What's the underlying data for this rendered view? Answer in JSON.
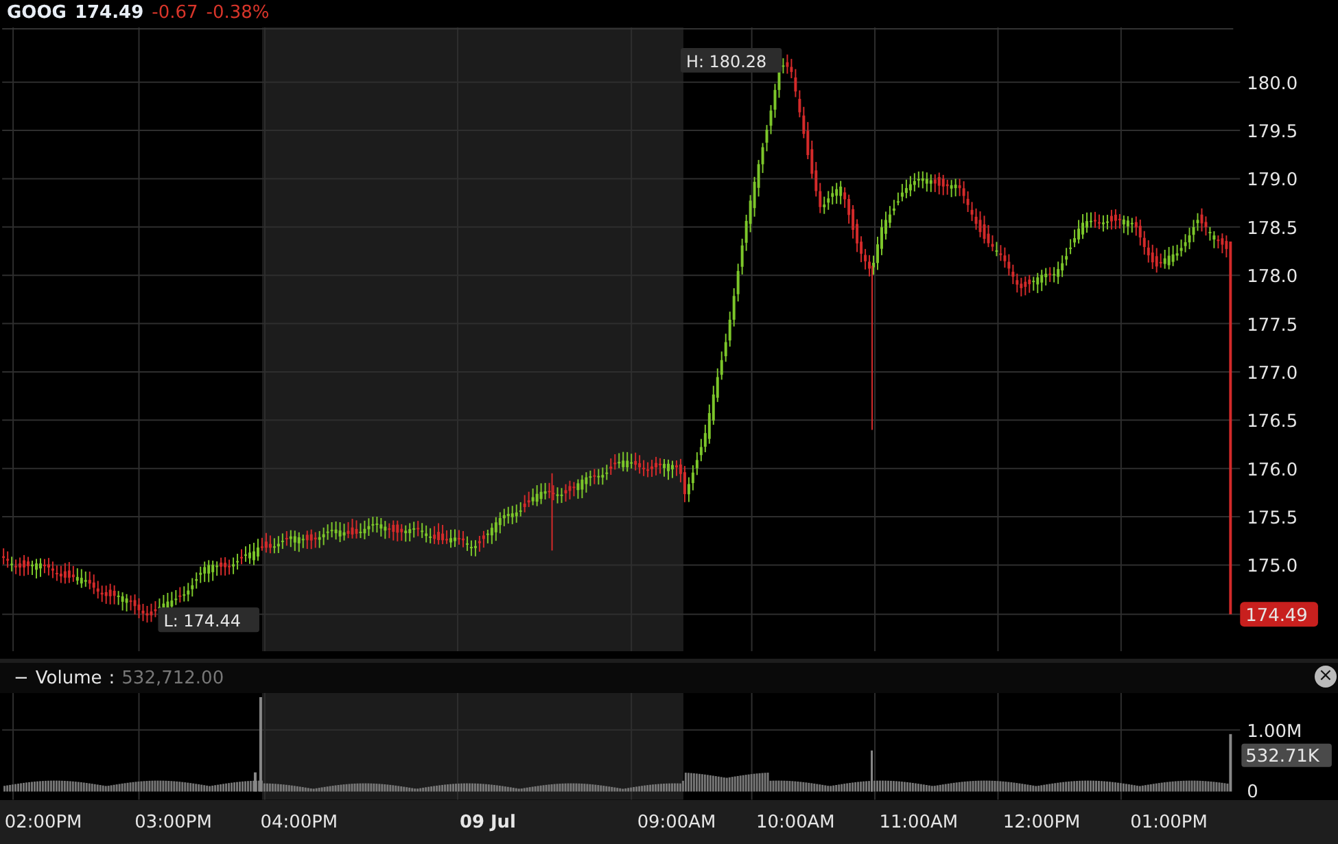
{
  "header": {
    "symbol": "GOOG",
    "price": "174.49",
    "change": "-0.67",
    "change_percent": "-0.38%"
  },
  "price_chart": {
    "axis_labels": [
      "180.0",
      "179.5",
      "179.0",
      "178.5",
      "178.0",
      "177.5",
      "177.0",
      "176.5",
      "176.0",
      "175.5",
      "175.0"
    ],
    "high_label": "H: 180.28",
    "low_label": "L: 174.44",
    "last_price": "174.49"
  },
  "volume": {
    "toggle": "−",
    "label": "Volume",
    "separator": ":",
    "value": "532,712.00",
    "close": "×",
    "axis_labels": [
      "1.00M",
      "0"
    ],
    "last_volume": "532.71K"
  },
  "time_axis": [
    {
      "label": "02:00PM",
      "kind": "time"
    },
    {
      "label": "03:00PM",
      "kind": "time"
    },
    {
      "label": "04:00PM",
      "kind": "time"
    },
    {
      "label": "09 Jul",
      "kind": "date"
    },
    {
      "label": "09:00AM",
      "kind": "time"
    },
    {
      "label": "10:00AM",
      "kind": "time"
    },
    {
      "label": "11:00AM",
      "kind": "time"
    },
    {
      "label": "12:00PM",
      "kind": "time"
    },
    {
      "label": "01:00PM",
      "kind": "time"
    }
  ]
}
